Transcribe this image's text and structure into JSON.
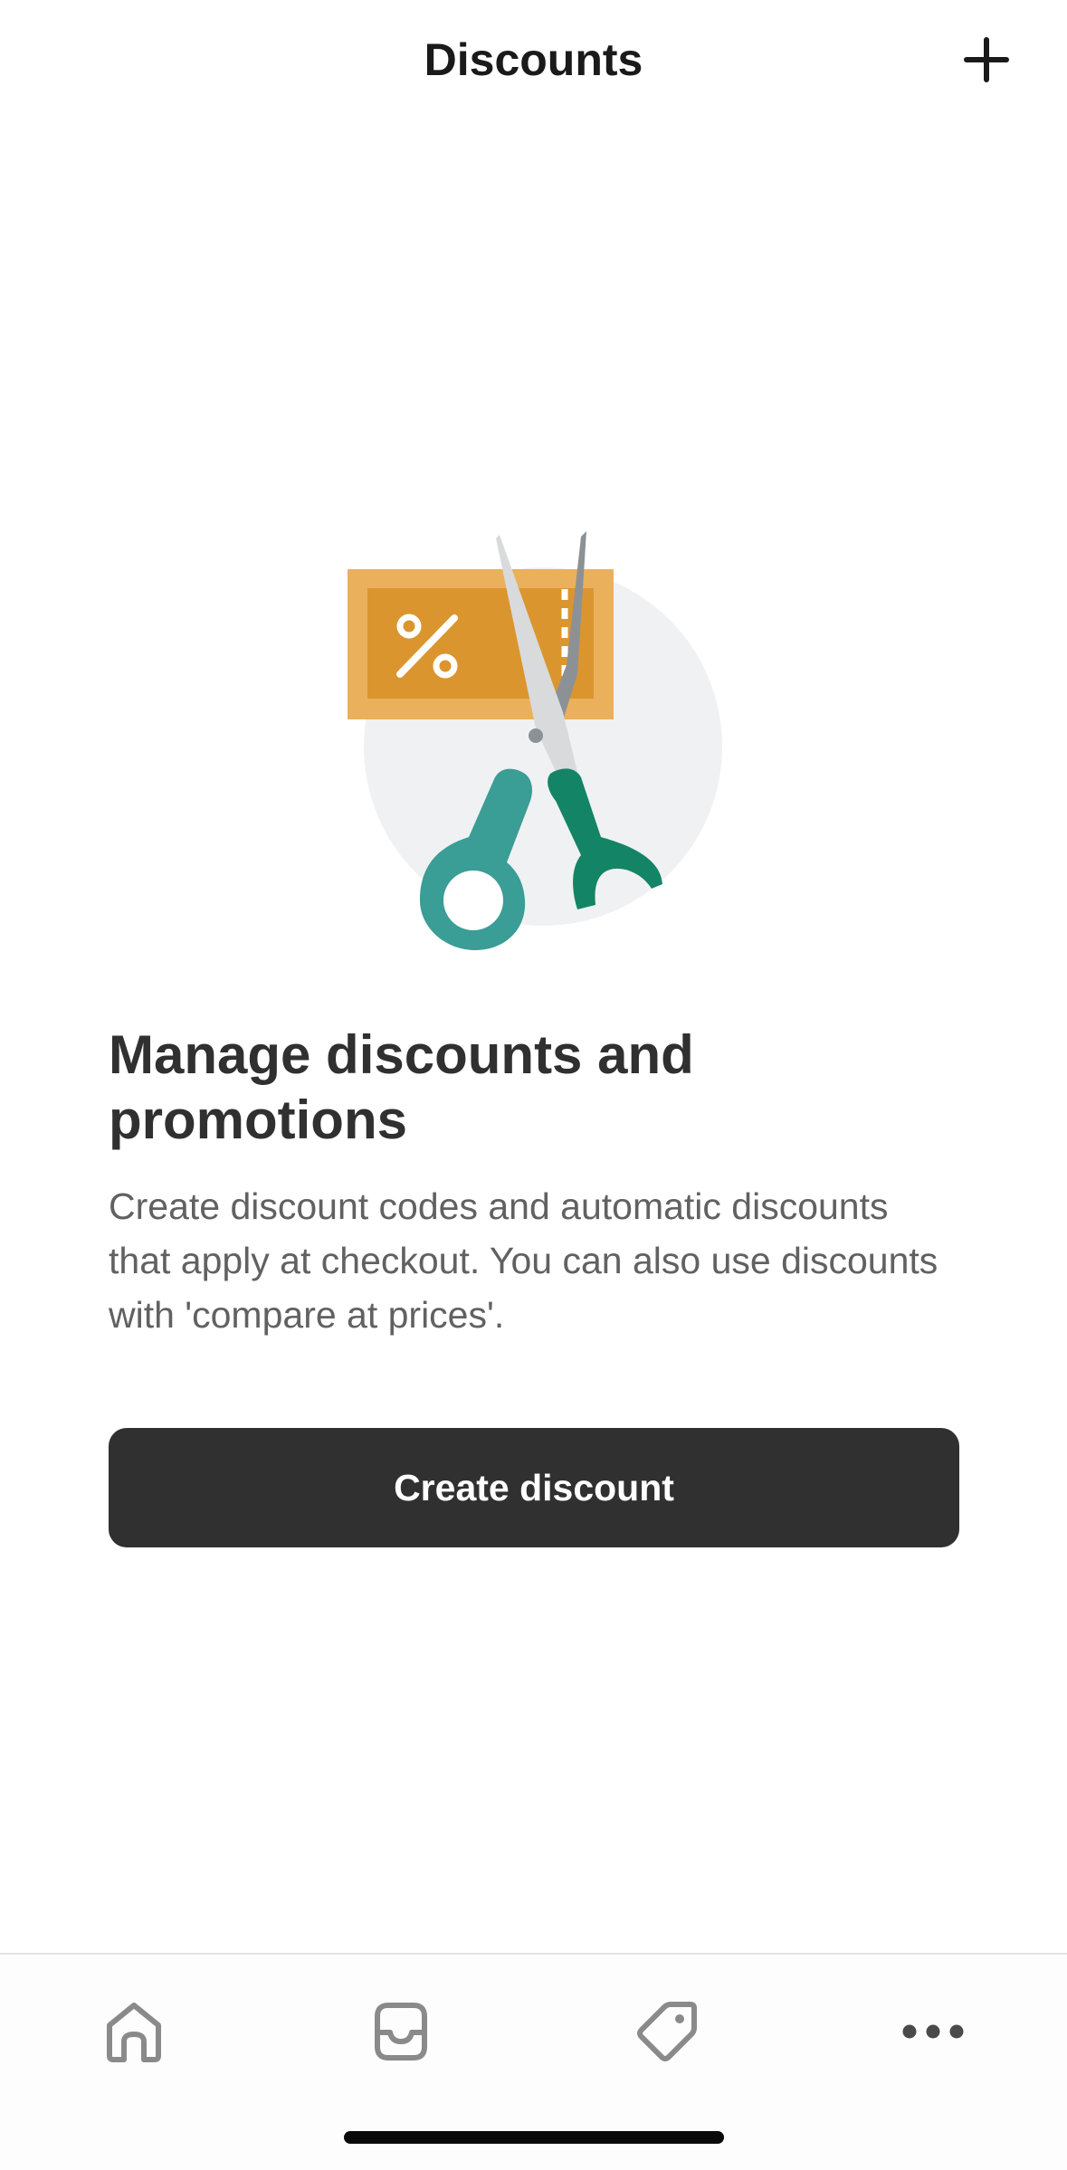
{
  "header": {
    "title": "Discounts",
    "add_icon": "plus-icon"
  },
  "illustration": {
    "description_icon": "scissors-cutting-coupon-icon",
    "coupon_symbol": "%",
    "colors": {
      "coupon_outer": "#EAB05C",
      "coupon_inner": "#DB952F",
      "circle": "#F0F1F2",
      "handle_left": "#3A9D96",
      "handle_right": "#138566",
      "blade": "#D9DADB"
    }
  },
  "empty_state": {
    "title": "Manage discounts and promotions",
    "description": "Create discount codes and automatic discounts that apply at checkout. You can also use discounts with 'compare at prices'.",
    "button_label": "Create discount"
  },
  "tabbar": {
    "tabs": [
      {
        "id": "home",
        "icon": "home-icon"
      },
      {
        "id": "orders",
        "icon": "inbox-icon"
      },
      {
        "id": "products",
        "icon": "tag-icon"
      },
      {
        "id": "more",
        "icon": "more-dots-icon"
      }
    ]
  },
  "colors": {
    "primary_button": "#303030",
    "text_primary": "#303030",
    "text_secondary": "#616161",
    "icon": "#8A8A8A"
  }
}
